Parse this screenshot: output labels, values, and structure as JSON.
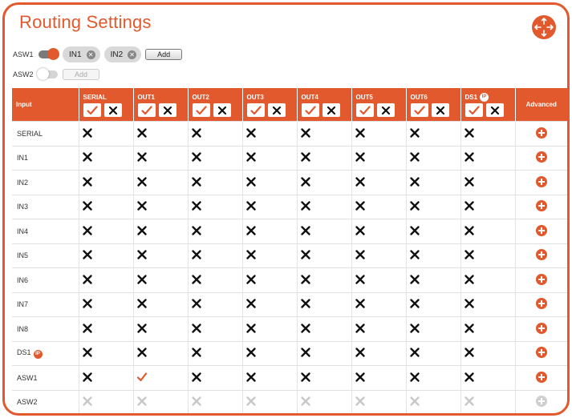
{
  "title": "Routing Settings",
  "colors": {
    "accent": "#e2592d",
    "x_mark": "#111111",
    "x_dim": "#c8c8c8"
  },
  "controls": {
    "asw1": {
      "label": "ASW1",
      "toggle_on": true,
      "chips": [
        "IN1",
        "IN2"
      ],
      "add_label": "Add"
    },
    "asw2": {
      "label": "ASW2",
      "toggle_on": false,
      "add_label": "Add"
    }
  },
  "table": {
    "input_header": "Input",
    "advanced_header": "Advanced",
    "columns": [
      {
        "name": "SERIAL",
        "ip": false
      },
      {
        "name": "OUT1",
        "ip": false
      },
      {
        "name": "OUT2",
        "ip": false
      },
      {
        "name": "OUT3",
        "ip": false
      },
      {
        "name": "OUT4",
        "ip": false
      },
      {
        "name": "OUT5",
        "ip": false
      },
      {
        "name": "OUT6",
        "ip": false
      },
      {
        "name": "DS1",
        "ip": true
      }
    ],
    "ip_badge": "IP",
    "rows": [
      {
        "name": "SERIAL",
        "ip": false,
        "disabled": false,
        "routes": [
          "x",
          "x",
          "x",
          "x",
          "x",
          "x",
          "x",
          "x"
        ]
      },
      {
        "name": "IN1",
        "ip": false,
        "disabled": false,
        "routes": [
          "x",
          "x",
          "x",
          "x",
          "x",
          "x",
          "x",
          "x"
        ]
      },
      {
        "name": "IN2",
        "ip": false,
        "disabled": false,
        "routes": [
          "x",
          "x",
          "x",
          "x",
          "x",
          "x",
          "x",
          "x"
        ]
      },
      {
        "name": "IN3",
        "ip": false,
        "disabled": false,
        "routes": [
          "x",
          "x",
          "x",
          "x",
          "x",
          "x",
          "x",
          "x"
        ]
      },
      {
        "name": "IN4",
        "ip": false,
        "disabled": false,
        "routes": [
          "x",
          "x",
          "x",
          "x",
          "x",
          "x",
          "x",
          "x"
        ]
      },
      {
        "name": "IN5",
        "ip": false,
        "disabled": false,
        "routes": [
          "x",
          "x",
          "x",
          "x",
          "x",
          "x",
          "x",
          "x"
        ]
      },
      {
        "name": "IN6",
        "ip": false,
        "disabled": false,
        "routes": [
          "x",
          "x",
          "x",
          "x",
          "x",
          "x",
          "x",
          "x"
        ]
      },
      {
        "name": "IN7",
        "ip": false,
        "disabled": false,
        "routes": [
          "x",
          "x",
          "x",
          "x",
          "x",
          "x",
          "x",
          "x"
        ]
      },
      {
        "name": "IN8",
        "ip": false,
        "disabled": false,
        "routes": [
          "x",
          "x",
          "x",
          "x",
          "x",
          "x",
          "x",
          "x"
        ]
      },
      {
        "name": "DS1",
        "ip": true,
        "disabled": false,
        "routes": [
          "x",
          "x",
          "x",
          "x",
          "x",
          "x",
          "x",
          "x"
        ]
      },
      {
        "name": "ASW1",
        "ip": false,
        "disabled": false,
        "routes": [
          "x",
          "check",
          "x",
          "x",
          "x",
          "x",
          "x",
          "x"
        ]
      },
      {
        "name": "ASW2",
        "ip": false,
        "disabled": true,
        "routes": [
          "x",
          "x",
          "x",
          "x",
          "x",
          "x",
          "x",
          "x"
        ]
      }
    ]
  }
}
